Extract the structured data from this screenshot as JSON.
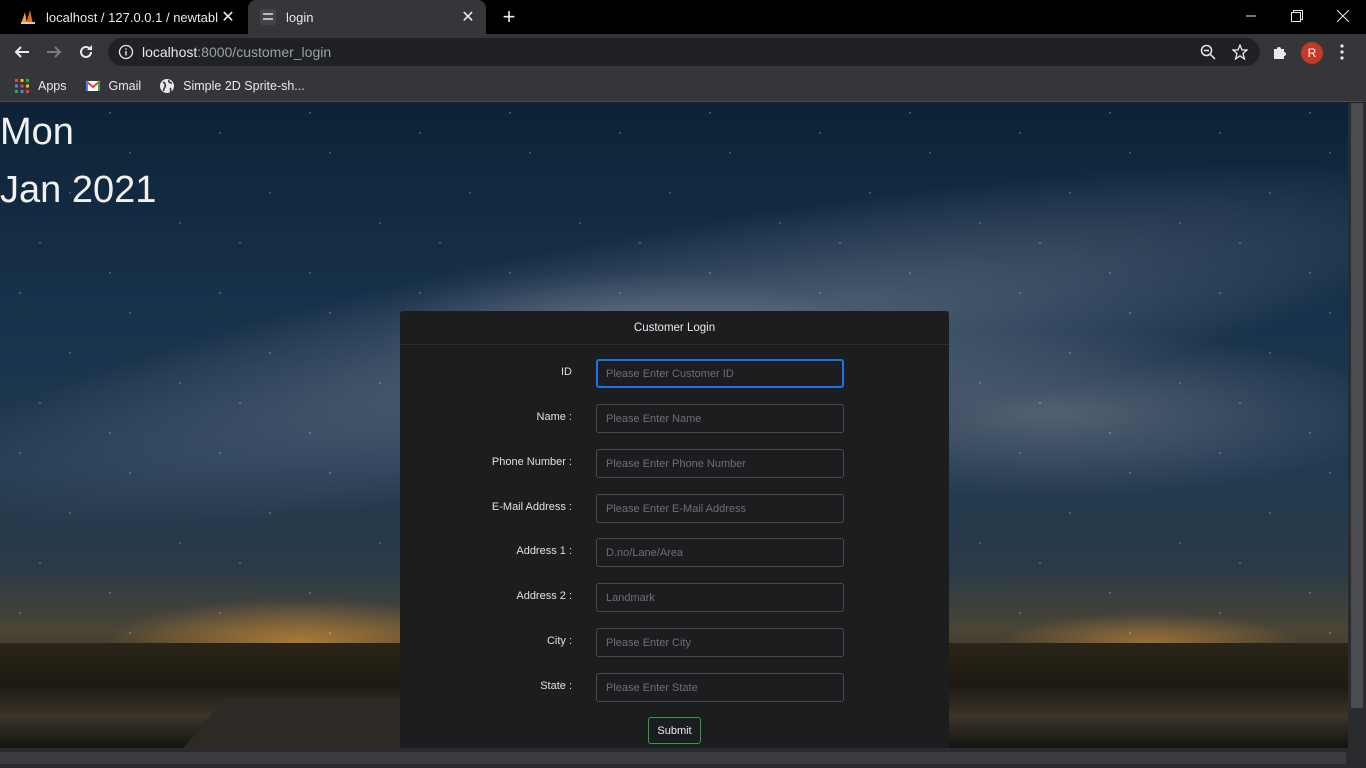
{
  "browser": {
    "tabs": [
      {
        "title": "localhost / 127.0.0.1 / newtable /",
        "active": false
      },
      {
        "title": "login",
        "active": true
      }
    ],
    "new_tab_symbol": "+",
    "url_host": "localhost",
    "url_rest": ":8000/customer_login",
    "profile_initial": "R",
    "window_controls": {
      "minimize": "minimize-icon",
      "restore": "restore-icon",
      "close": "close-icon"
    },
    "bookmarks": [
      {
        "label": "Apps",
        "icon": "apps-grid-icon"
      },
      {
        "label": "Gmail",
        "icon": "gmail-icon"
      },
      {
        "label": "Simple 2D Sprite-sh...",
        "icon": "globe-icon"
      }
    ]
  },
  "page": {
    "date_day": "Mon",
    "date_month": "Jan 2021",
    "form": {
      "title": "Customer Login",
      "fields": [
        {
          "label": "ID",
          "placeholder": "Please Enter Customer ID"
        },
        {
          "label": "Name :",
          "placeholder": "Please Enter Name"
        },
        {
          "label": "Phone Number :",
          "placeholder": "Please Enter Phone Number"
        },
        {
          "label": "E-Mail Address :",
          "placeholder": "Please Enter E-Mail Address"
        },
        {
          "label": "Address 1 :",
          "placeholder": "D.no/Lane/Area"
        },
        {
          "label": "Address 2 :",
          "placeholder": "Landmark"
        },
        {
          "label": "City :",
          "placeholder": "Please Enter City"
        },
        {
          "label": "State :",
          "placeholder": "Please Enter State"
        }
      ],
      "submit_label": "Submit"
    }
  },
  "colors": {
    "focus_border": "#1a73e8",
    "submit_border": "#2ea043",
    "avatar_bg": "#c53929"
  }
}
